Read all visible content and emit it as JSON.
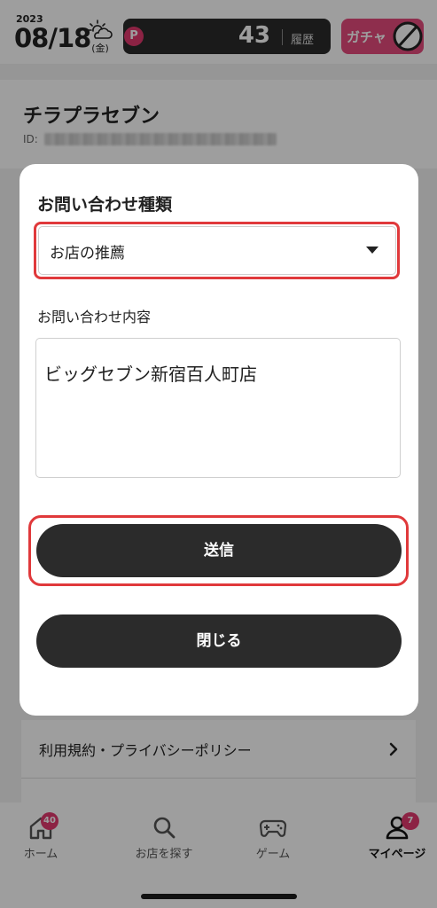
{
  "header": {
    "year": "2023",
    "date": "08/18",
    "weekday": "(金)",
    "points_badge": "P",
    "points": "43",
    "history_label": "履歴",
    "gacha_label": "ガチャ"
  },
  "profile": {
    "name": "チラプラセブン",
    "id_label": "ID:"
  },
  "modal": {
    "inquiry_type_label": "お問い合わせ種類",
    "inquiry_type_value": "お店の推薦",
    "inquiry_content_label": "お問い合わせ内容",
    "inquiry_content_value": "ビッグセブン新宿百人町店",
    "send_label": "送信",
    "close_label": "閉じる"
  },
  "menu": {
    "terms_label": "利用規約・プライバシーポリシー"
  },
  "tabbar": {
    "home": {
      "label": "ホーム",
      "badge": "40"
    },
    "search": {
      "label": "お店を探す"
    },
    "game": {
      "label": "ゲーム"
    },
    "mypage": {
      "label": "マイページ",
      "badge": "7"
    }
  },
  "colors": {
    "accent_pink": "#e2396e",
    "highlight_red": "#e0393b",
    "button_dark": "#2b2b2b"
  }
}
